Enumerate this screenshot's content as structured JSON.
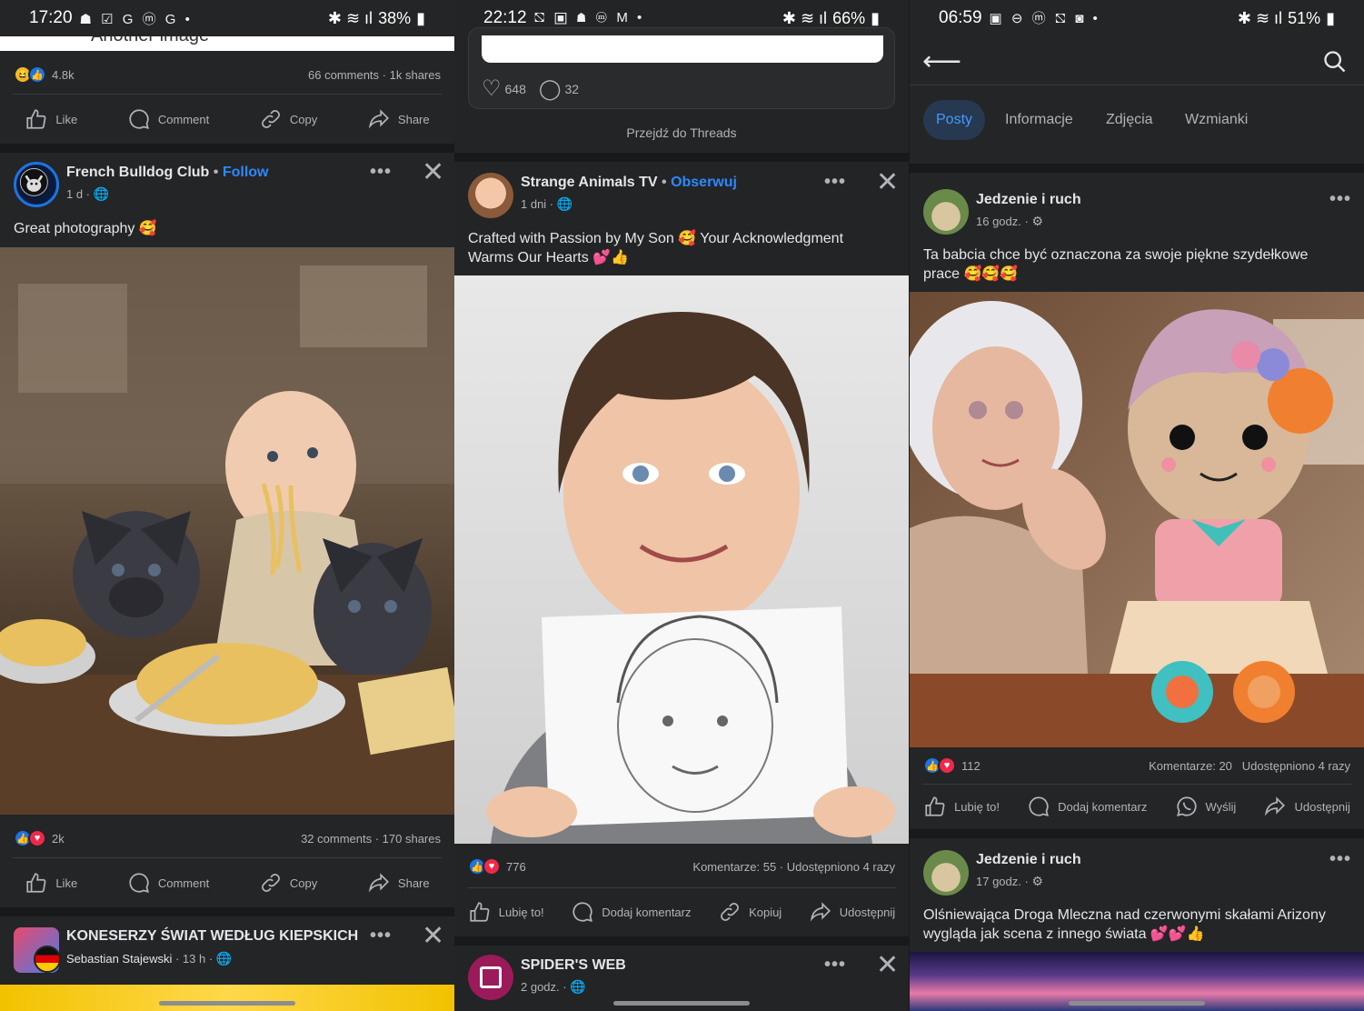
{
  "panel1": {
    "status": {
      "time": "17:20",
      "icons": "☗ ☑ G ⓜ G •",
      "battery": "38%"
    },
    "prev_post": {
      "title_fragment": "Another image",
      "reaction_count": "4.8k",
      "comments": "66 comments",
      "shares": "1k shares"
    },
    "actions": {
      "like": "Like",
      "comment": "Comment",
      "copy": "Copy",
      "share": "Share"
    },
    "post1": {
      "page_name": "French Bulldog Club",
      "follow": "Follow",
      "meta": "1 d ·",
      "caption": "Great photography 🥰",
      "reaction_count": "2k",
      "comments": "32 comments",
      "shares": "170 shares"
    },
    "post2": {
      "page_name": "KONESERZY ŚWIAT WEDŁUG KIEPSKICH",
      "author": "Sebastian Stajewski",
      "meta": "13 h ·"
    }
  },
  "panel2": {
    "status": {
      "time": "22:12",
      "icons": "⛞ ▣ ☗ ⓜ M •",
      "battery": "66%"
    },
    "threads_card": {
      "likes": "648",
      "replies": "32",
      "link": "Przejdź do Threads"
    },
    "post1": {
      "page_name": "Strange Animals TV",
      "follow": "Obserwuj",
      "meta": "1 dni ·",
      "caption": "Crafted with Passion by My Son 🥰 Your Acknowledgment Warms Our Hearts 💕👍",
      "reaction_count": "776",
      "comments": "Komentarze: 55",
      "shares": "Udostępniono 4 razy"
    },
    "actions": {
      "like": "Lubię to!",
      "comment": "Dodaj komentarz",
      "copy": "Kopiuj",
      "share": "Udostępnij"
    },
    "post2": {
      "page_name": "SPIDER'S WEB",
      "meta": "2 godz. ·"
    }
  },
  "panel3": {
    "status": {
      "time": "06:59",
      "icons": "▣ ⊖ ⓜ ⛞ ◙ •",
      "battery": "51%"
    },
    "tabs": [
      "Posty",
      "Informacje",
      "Zdjęcia",
      "Wzmianki"
    ],
    "post1": {
      "page_name": "Jedzenie i ruch",
      "meta": "16 godz. ·",
      "caption": "Ta babcia chce być oznaczona za swoje piękne szydełkowe prace 🥰🥰🥰",
      "reaction_count": "112",
      "comments": "Komentarze: 20",
      "shares": "Udostępniono 4 razy"
    },
    "actions": {
      "like": "Lubię to!",
      "comment": "Dodaj komentarz",
      "send": "Wyślij",
      "share": "Udostępnij"
    },
    "post2": {
      "page_name": "Jedzenie i ruch",
      "meta": "17 godz. ·",
      "caption": "Olśniewająca Droga Mleczna nad czerwonymi skałami Arizony wygląda jak scena z innego świata 💕💕👍"
    }
  },
  "colors": {
    "bg": "#242526",
    "link": "#2d88ff",
    "tab_active_bg": "#263951",
    "tab_active_text": "#4599ff"
  }
}
